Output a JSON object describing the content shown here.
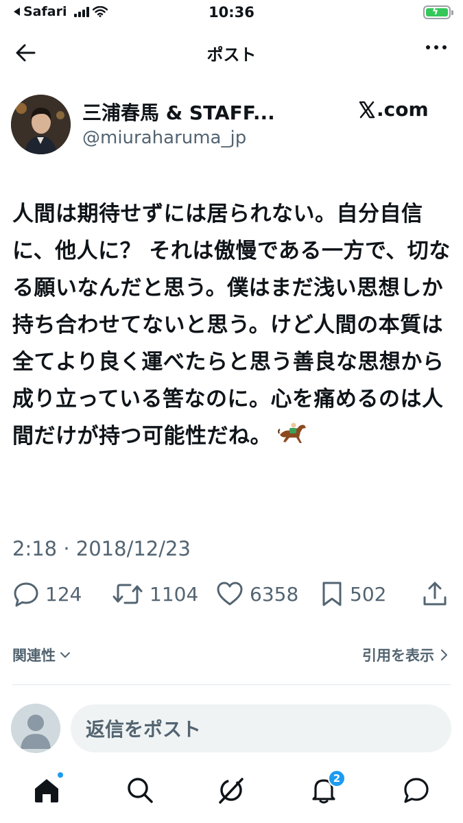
{
  "status_bar": {
    "back_app": "Safari",
    "time": "10:36"
  },
  "header": {
    "title": "ポスト"
  },
  "author": {
    "name": "三浦春馬 & STAFF...",
    "handle": "@miuraharuma_jp",
    "source": ".com"
  },
  "tweet": {
    "text": "人間は期待せずには居られない。自分自信に、他人に？ それは傲慢である一方で、切なる願いなんだと思う。僕はまだ浅い思想しか持ち合わせてないと思う。けど人間の本質は全てより良く運べたらと思う善良な思想から成り立っている筈なのに。心を痛めるのは人間だけが持つ可能性だね。",
    "emoji_icon": "horse-racing-icon",
    "timestamp": "2:18 · 2018/12/23"
  },
  "actions": {
    "replies": "124",
    "reposts": "1104",
    "likes": "6358",
    "bookmarks": "502"
  },
  "relevance": {
    "sort_label": "関連性",
    "quotes_label": "引用を表示"
  },
  "reply": {
    "placeholder": "返信をポスト"
  },
  "tabbar": {
    "notifications_badge": "2"
  },
  "colors": {
    "text": "#0f1419",
    "secondary": "#536471",
    "accent": "#1d9bf0",
    "battery": "#34c759"
  }
}
